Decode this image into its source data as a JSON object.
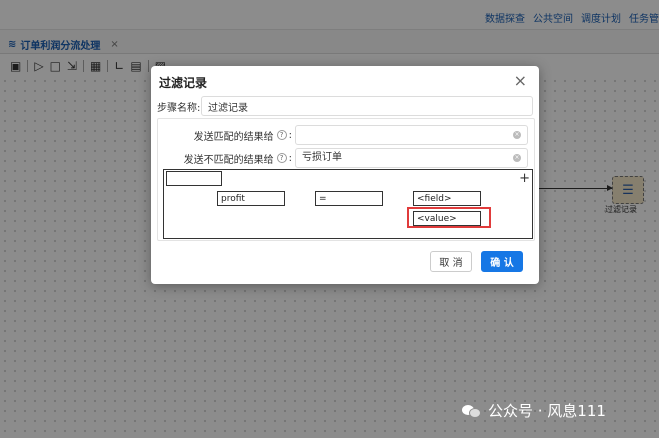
{
  "topnav": {
    "items": [
      "数据探查",
      "公共空间",
      "调度计划",
      "任务管"
    ]
  },
  "tab": {
    "label": "订单利润分流处理",
    "close": "×"
  },
  "canvas": {
    "node_label": "过滤记录"
  },
  "dialog": {
    "title": "过滤记录",
    "close": "×",
    "step_name_label": "步骤名称:",
    "step_name_value": "过滤记录",
    "send_match_label": "发送匹配的结果给",
    "send_match_value": "",
    "send_nomatch_label": "发送不匹配的结果给",
    "send_nomatch_value": "亏损订单",
    "help": "?",
    "colon": ":",
    "condition": {
      "top_value": "",
      "field": "profit",
      "operator": "=",
      "compare_field": "<field>",
      "compare_value": "<value>",
      "add": "+"
    },
    "cancel_label": "取 消",
    "ok_label": "确 认"
  },
  "watermark": {
    "text": "公众号 · 风息111"
  },
  "colors": {
    "primary": "#1677e5",
    "highlight": "#e03b3b",
    "nav_text": "#1a5fb4"
  }
}
